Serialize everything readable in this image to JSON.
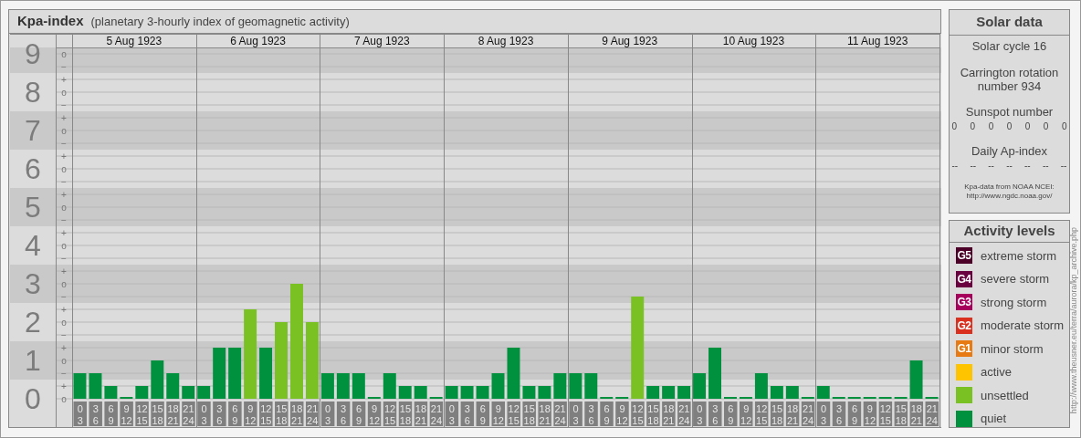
{
  "header": {
    "title": "Kpa-index",
    "subtitle": "(planetary 3-hourly index of geomagnetic activity)"
  },
  "days": [
    "5 Aug 1923",
    "6 Aug 1923",
    "7 Aug 1923",
    "8 Aug 1923",
    "9 Aug 1923",
    "10 Aug 1923",
    "11 Aug 1923"
  ],
  "scale_marks": [
    "o",
    "−",
    "+",
    "o",
    "−",
    "+",
    "o",
    "−",
    "+",
    "o",
    "−",
    "+",
    "o",
    "−",
    "+",
    "o",
    "−",
    "+",
    "o",
    "−",
    "+",
    "o",
    "−",
    "+",
    "o",
    "−",
    "+",
    "o"
  ],
  "chart_data": {
    "type": "bar",
    "stacked": true,
    "grid": true,
    "ylim": [
      0,
      9
    ],
    "yticks": [
      0,
      1,
      2,
      3,
      4,
      5,
      6,
      7,
      8,
      9
    ],
    "categories": [
      "0\n3",
      "3\n6",
      "6\n9",
      "9\n12",
      "12\n15",
      "15\n18",
      "18\n21",
      "21\n24",
      "0\n3",
      "3\n6",
      "6\n9",
      "9\n12",
      "12\n15",
      "15\n18",
      "18\n21",
      "21\n24",
      "0\n3",
      "3\n6",
      "6\n9",
      "9\n12",
      "12\n15",
      "15\n18",
      "18\n21",
      "21\n24",
      "0\n3",
      "3\n6",
      "6\n9",
      "9\n12",
      "12\n15",
      "15\n18",
      "18\n21",
      "21\n24",
      "0\n3",
      "3\n6",
      "6\n9",
      "9\n12",
      "12\n15",
      "15\n18",
      "18\n21",
      "21\n24",
      "0\n3",
      "3\n6",
      "6\n9",
      "9\n12",
      "12\n15",
      "15\n18",
      "18\n21",
      "21\n24",
      "0\n3",
      "3\n6",
      "6\n9",
      "9\n12",
      "12\n15",
      "15\n18",
      "18\n21",
      "21\n24"
    ],
    "series": [
      {
        "name": "quiet",
        "color": "#00913f",
        "values": [
          0.67,
          0.67,
          0.33,
          0,
          0.33,
          1,
          0.67,
          0.33,
          0.33,
          1.33,
          1.33,
          null,
          1.33,
          null,
          null,
          null,
          0.67,
          0.67,
          0.67,
          0,
          0.67,
          0.33,
          0.33,
          0,
          0.33,
          0.33,
          0.33,
          0.67,
          1.33,
          0.33,
          0.33,
          0.67,
          0.67,
          0.67,
          0,
          0,
          null,
          0.33,
          0.33,
          0.33,
          0.67,
          1.33,
          0,
          0,
          0.67,
          0.33,
          0.33,
          0,
          0.33,
          0,
          0,
          0,
          0,
          0,
          1,
          0
        ]
      },
      {
        "name": "unsettled",
        "color": "#7ac124",
        "values": [
          null,
          null,
          null,
          null,
          null,
          null,
          null,
          null,
          null,
          null,
          null,
          2.33,
          null,
          2,
          3,
          2,
          null,
          null,
          null,
          null,
          null,
          null,
          null,
          null,
          null,
          null,
          null,
          null,
          null,
          null,
          null,
          null,
          null,
          null,
          null,
          null,
          2.67,
          null,
          null,
          null,
          null,
          null,
          null,
          null,
          null,
          null,
          null,
          null,
          null,
          null,
          null,
          null,
          null,
          null,
          null,
          null
        ]
      }
    ]
  },
  "solar_data": {
    "title": "Solar data",
    "solar_cycle": "Solar cycle 16",
    "carrington": "Carrington rotation number 934",
    "sunspot_title": "Sunspot number",
    "sunspot_numbers": [
      "0",
      "0",
      "0",
      "0",
      "0",
      "0",
      "0"
    ],
    "ap_title": "Daily Ap-index",
    "ap_values": [
      "--",
      "--",
      "--",
      "--",
      "--",
      "--",
      "--"
    ],
    "source": "Kpa-data from NOAA NCEI:",
    "source_url": "http://www.ngdc.noaa.gov/"
  },
  "activity_levels": {
    "title": "Activity levels",
    "items": [
      {
        "badge": "G5",
        "label": "extreme storm",
        "color": "#4d0027"
      },
      {
        "badge": "G4",
        "label": "severe storm",
        "color": "#6b0040"
      },
      {
        "badge": "G3",
        "label": "strong storm",
        "color": "#a6005c"
      },
      {
        "badge": "G2",
        "label": "moderate storm",
        "color": "#d9301f"
      },
      {
        "badge": "G1",
        "label": "minor storm",
        "color": "#e77a12"
      },
      {
        "label": "active",
        "color": "#ffc400"
      }
    ]
  },
  "credit": "http://www.theusner.eu/terra/aurora/kp_archive.php"
}
